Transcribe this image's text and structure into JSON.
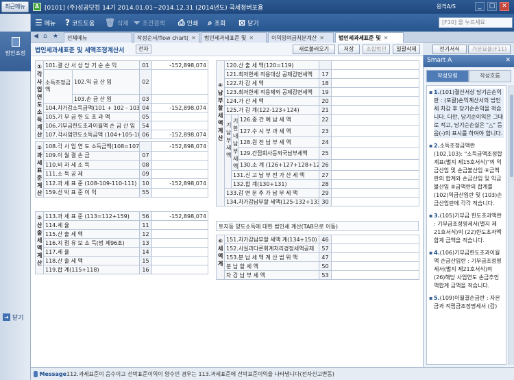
{
  "titlebar": {
    "recent_label": "최근메뉴",
    "app_icon": "A",
    "title": "[0101] (주)성공닷컴    14기  2014.01.01~2014.12.31 (2014년도)   국세청버포용",
    "remote": "원격A/S",
    "min": "_",
    "max": "□",
    "close": "✕"
  },
  "toolbar": {
    "menu": "메뉴",
    "codehelp": "코드도움",
    "delete": "삭제",
    "condsearch": "조건검색",
    "print": "인쇄",
    "query": "조회",
    "close": "닫기",
    "search_placeholder": "[F10] 을 누르세요"
  },
  "leftrail": {
    "corp_label": "법인조정",
    "close_label": "닫기"
  },
  "tabs": [
    {
      "label": "전체메뉴"
    },
    {
      "label": "작성순서/flow chart("
    },
    {
      "label": "법인세과세표준 및"
    },
    {
      "label": "이익잉여금처분계산"
    },
    {
      "label": "법인세과세표준 및"
    }
  ],
  "pagehead": {
    "title": "법인세과세표준 및 세액조정계산서",
    "badge": "전자",
    "buttons": [
      "새로불러오기",
      "저장",
      "조합법인",
      "일괄삭제",
      "전기서식",
      "가분요율(F11)"
    ]
  },
  "left": {
    "g1": {
      "title": "① 각 사업연도 소득계산",
      "rows": [
        {
          "label": "101.결 산 서 상 당 기 순 손 익",
          "code": "01",
          "value": "-152,898,074"
        },
        {
          "label": "102.익  금  산  입",
          "code": "02",
          "value": ""
        },
        {
          "label": "103.손  금  산  입",
          "code": "03",
          "value": ""
        },
        {
          "label": "104.차가감소득금액(101 + 102 - 103)",
          "code": "04",
          "value": "-152,898,074"
        },
        {
          "label": "105.기 부 금 한 도 초 과 액",
          "code": "05",
          "value": ""
        },
        {
          "label": "106.기부금한도초과이월액 손 금 산 입",
          "code": "54",
          "value": ""
        },
        {
          "label": "107.각사업연도소득금액 (104+105-106)",
          "code": "06",
          "value": "-152,898,074"
        }
      ],
      "sublabel": "소득조정금  액"
    },
    "g2": {
      "title": "② 과세표준계산",
      "rows": [
        {
          "label": "108.각 사 업 연 도 소득금액(108=107)",
          "code": "",
          "value": "-152,898,074"
        },
        {
          "label": "109.이     월     결     손     금",
          "code": "07",
          "value": ""
        },
        {
          "label": "110.비     과     세     소     득",
          "code": "08",
          "value": ""
        },
        {
          "label": "111.소          득          공          제",
          "code": "09",
          "value": ""
        },
        {
          "label": "112.과  세  표  준  (108-109-110-111)",
          "code": "10",
          "value": "-152,898,074"
        },
        {
          "label": "159.선     박     표     준     이     익",
          "code": "55",
          "value": ""
        }
      ]
    },
    "g3": {
      "title": "③ 산출세액계산",
      "rows": [
        {
          "label": "113.과   세   표   준   (113=112+159)",
          "code": "56",
          "value": "-152,898,074"
        },
        {
          "label": "114.세                                  율",
          "code": "11",
          "value": ""
        },
        {
          "label": "115.산          출          세          액",
          "code": "12",
          "value": ""
        },
        {
          "label": "116.지 점 유 보 소 득(법 제96조)",
          "code": "13",
          "value": ""
        },
        {
          "label": "117.세                                  율",
          "code": "14",
          "value": ""
        },
        {
          "label": "118.산          출          세          액",
          "code": "15",
          "value": ""
        },
        {
          "label": "119.합                    계(115+118)",
          "code": "16",
          "value": ""
        }
      ]
    }
  },
  "right": {
    "g4": {
      "title": "④ 납부할세액계산",
      "rows": [
        {
          "label": "120.산       출       세       액(120=119)",
          "code": "",
          "value": ""
        },
        {
          "label": "121.최저한세 적용대상 공제감면세액",
          "code": "17",
          "value": ""
        },
        {
          "label": "122.차             감             세             액",
          "code": "18",
          "value": ""
        },
        {
          "label": "123.최저한세 적용제외 공제감면세액",
          "code": "19",
          "value": ""
        },
        {
          "label": "124.가         산         세         액",
          "code": "20",
          "value": ""
        },
        {
          "label": "125.가      감       계(122-123+124)",
          "code": "21",
          "value": ""
        }
      ],
      "sub_outer": "기 납 부 세 액",
      "sub_inner": "기한내납부세액",
      "sub_rows": [
        {
          "label": "126.중 간 예 납 세 액",
          "code": "22",
          "value": ""
        },
        {
          "label": "127.수 시 부 과 세 액",
          "code": "23",
          "value": ""
        },
        {
          "label": "128.원 천 납 부 세 액",
          "code": "24",
          "value": ""
        },
        {
          "label": "129.간접회사등외국납부세액",
          "code": "25",
          "value": ""
        },
        {
          "label": "130.소 계 (126+127+128+129)",
          "code": "26",
          "value": ""
        },
        {
          "label": "131.신 고 납 부 전 가 산 세 액",
          "code": "27",
          "value": ""
        },
        {
          "label": "132.합          계(130+131)",
          "code": "28",
          "value": ""
        }
      ],
      "tail_rows": [
        {
          "label": "133.감  면  분  추  가  납  부  세  액",
          "code": "29",
          "value": ""
        },
        {
          "label": "134.차가감납부할 세액(125-132+133)",
          "code": "30",
          "value": ""
        }
      ]
    },
    "notice": "토지등 양도소득에 대한 법인세 계산(TAB으로 이동)",
    "g5": {
      "title": "⑥ 세액계",
      "rows": [
        {
          "label": "151.차가감납부할 세액 계(134+150)",
          "code": "46",
          "value": ""
        },
        {
          "label": "152.사실과다른회계처리경정세액공제",
          "code": "57",
          "value": ""
        },
        {
          "label": "153.분 납 세 액 계 산  범 위 액",
          "code": "47",
          "value": ""
        },
        {
          "label": "분          납          할          세          액",
          "code": "50",
          "value": ""
        },
        {
          "label": "차       감       납       부       세       액",
          "code": "53",
          "value": ""
        }
      ]
    }
  },
  "smart": {
    "title": "Smart A",
    "close": "✕",
    "tab_active": "작성요령",
    "tab_other": "작성흐름",
    "items": [
      {
        "num": "1.",
        "text": "(101)결산서상 당기순손익란 : (포괄)손익계산서의 법인세 차감 후 당기순손익을 적습니다. 다만, 당기순이익은 그대로 적고, 당기순손실은 \"△\" 등 음(-)의 표시를 하여야 합니다."
      },
      {
        "num": "2.",
        "text": "소득조정금액란(102,103): \"소득금액조정합계표(별지 제15호서식)\"의 익금산입 및 손금불산입 ④금액란의 합계와 손금산입 및 익금불산입 ⑤금액란의 합계를 (102)익금산입란 및 (103)손금산입란에 각각 적습니다."
      },
      {
        "num": "3.",
        "text": "(105)기부금 한도초과액란 : 기부금조정명세서(별지 제21호서식)의 (22)한도초과액 합계 금액을 적습니다."
      },
      {
        "num": "4.",
        "text": "(106)기부금한도초과이월액 손금산입란 : 기부금조정명세서(별지 제21호서식)의 (26)해당 사업연도 손금추인액합계 금액을 적습니다."
      },
      {
        "num": "5.",
        "text": "(109)이월결손금란 : 자본금과 적립금조정명세서 (갑)"
      }
    ]
  },
  "message": {
    "label": "Message",
    "text": "112.과세표준이 음수이고 선박표준이익이 양수인 경우는 113.과세표준에 선박표준이익을 나타냅니다(전자신고변동)"
  }
}
